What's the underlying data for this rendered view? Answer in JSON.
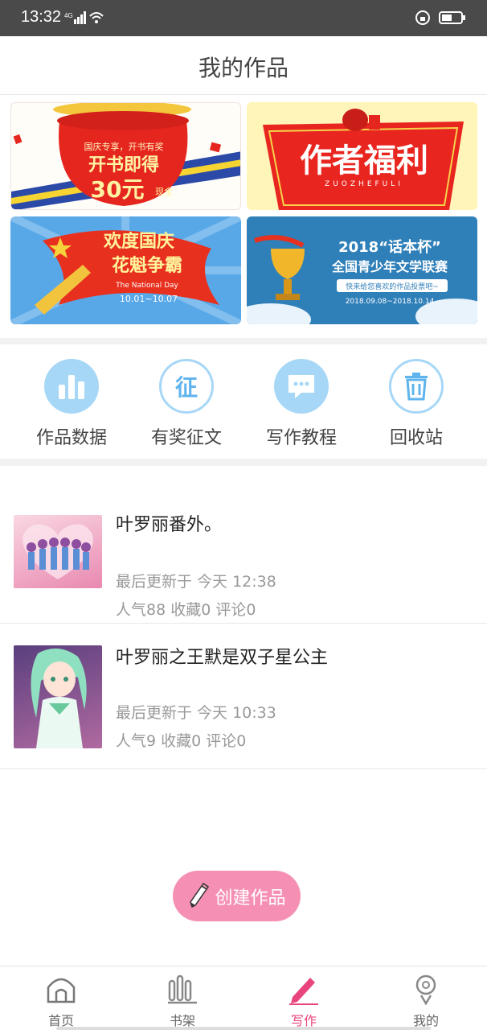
{
  "status": {
    "time": "13:32",
    "network": "4G"
  },
  "header": {
    "title": "我的作品"
  },
  "banners": [
    {
      "name": "national-day-banner",
      "lines": [
        "国庆专享，开书有奖",
        "开书即得",
        "30元",
        "现金"
      ]
    },
    {
      "name": "author-benefit-banner",
      "lines": [
        "作者福利",
        "ZUOZHEFULI"
      ]
    },
    {
      "name": "celebrate-banner",
      "lines": [
        "欢度国庆",
        "花魁争霸",
        "The National Day",
        "10.01~10.07"
      ]
    },
    {
      "name": "contest-banner",
      "lines": [
        "2018“话本杯”",
        "全国青少年文学联赛",
        "快来给您喜欢的作品投票吧~",
        "2018.09.08~2018.10.14"
      ]
    }
  ],
  "actions": [
    {
      "label": "作品数据",
      "icon": "bar-chart-icon"
    },
    {
      "label": "有奖征文",
      "icon": "zheng-icon",
      "glyph": "征"
    },
    {
      "label": "写作教程",
      "icon": "chat-bubble-icon"
    },
    {
      "label": "回收站",
      "icon": "trash-icon"
    }
  ],
  "works": [
    {
      "title": "叶罗丽番外。",
      "updated": "最后更新于 今天 12:38",
      "stats": "人气88 收藏0 评论0",
      "cover_colors": [
        "#f7c8d6",
        "#e58bb0"
      ]
    },
    {
      "title": "叶罗丽之王默是双子星公主",
      "updated": "最后更新于 今天 10:33",
      "stats": "人气9 收藏0 评论0",
      "cover_colors": [
        "#6d4b88",
        "#9bd9b5"
      ]
    }
  ],
  "create_button": {
    "label": "创建作品"
  },
  "nav": [
    {
      "label": "首页",
      "icon": "home-icon",
      "active": false
    },
    {
      "label": "书架",
      "icon": "bookshelf-icon",
      "active": false
    },
    {
      "label": "写作",
      "icon": "pencil-icon",
      "active": true
    },
    {
      "label": "我的",
      "icon": "profile-icon",
      "active": false
    }
  ],
  "colors": {
    "accent": "#e8457f",
    "icon_blue": "#5fb4ee",
    "button_pink": "#f590b4"
  }
}
